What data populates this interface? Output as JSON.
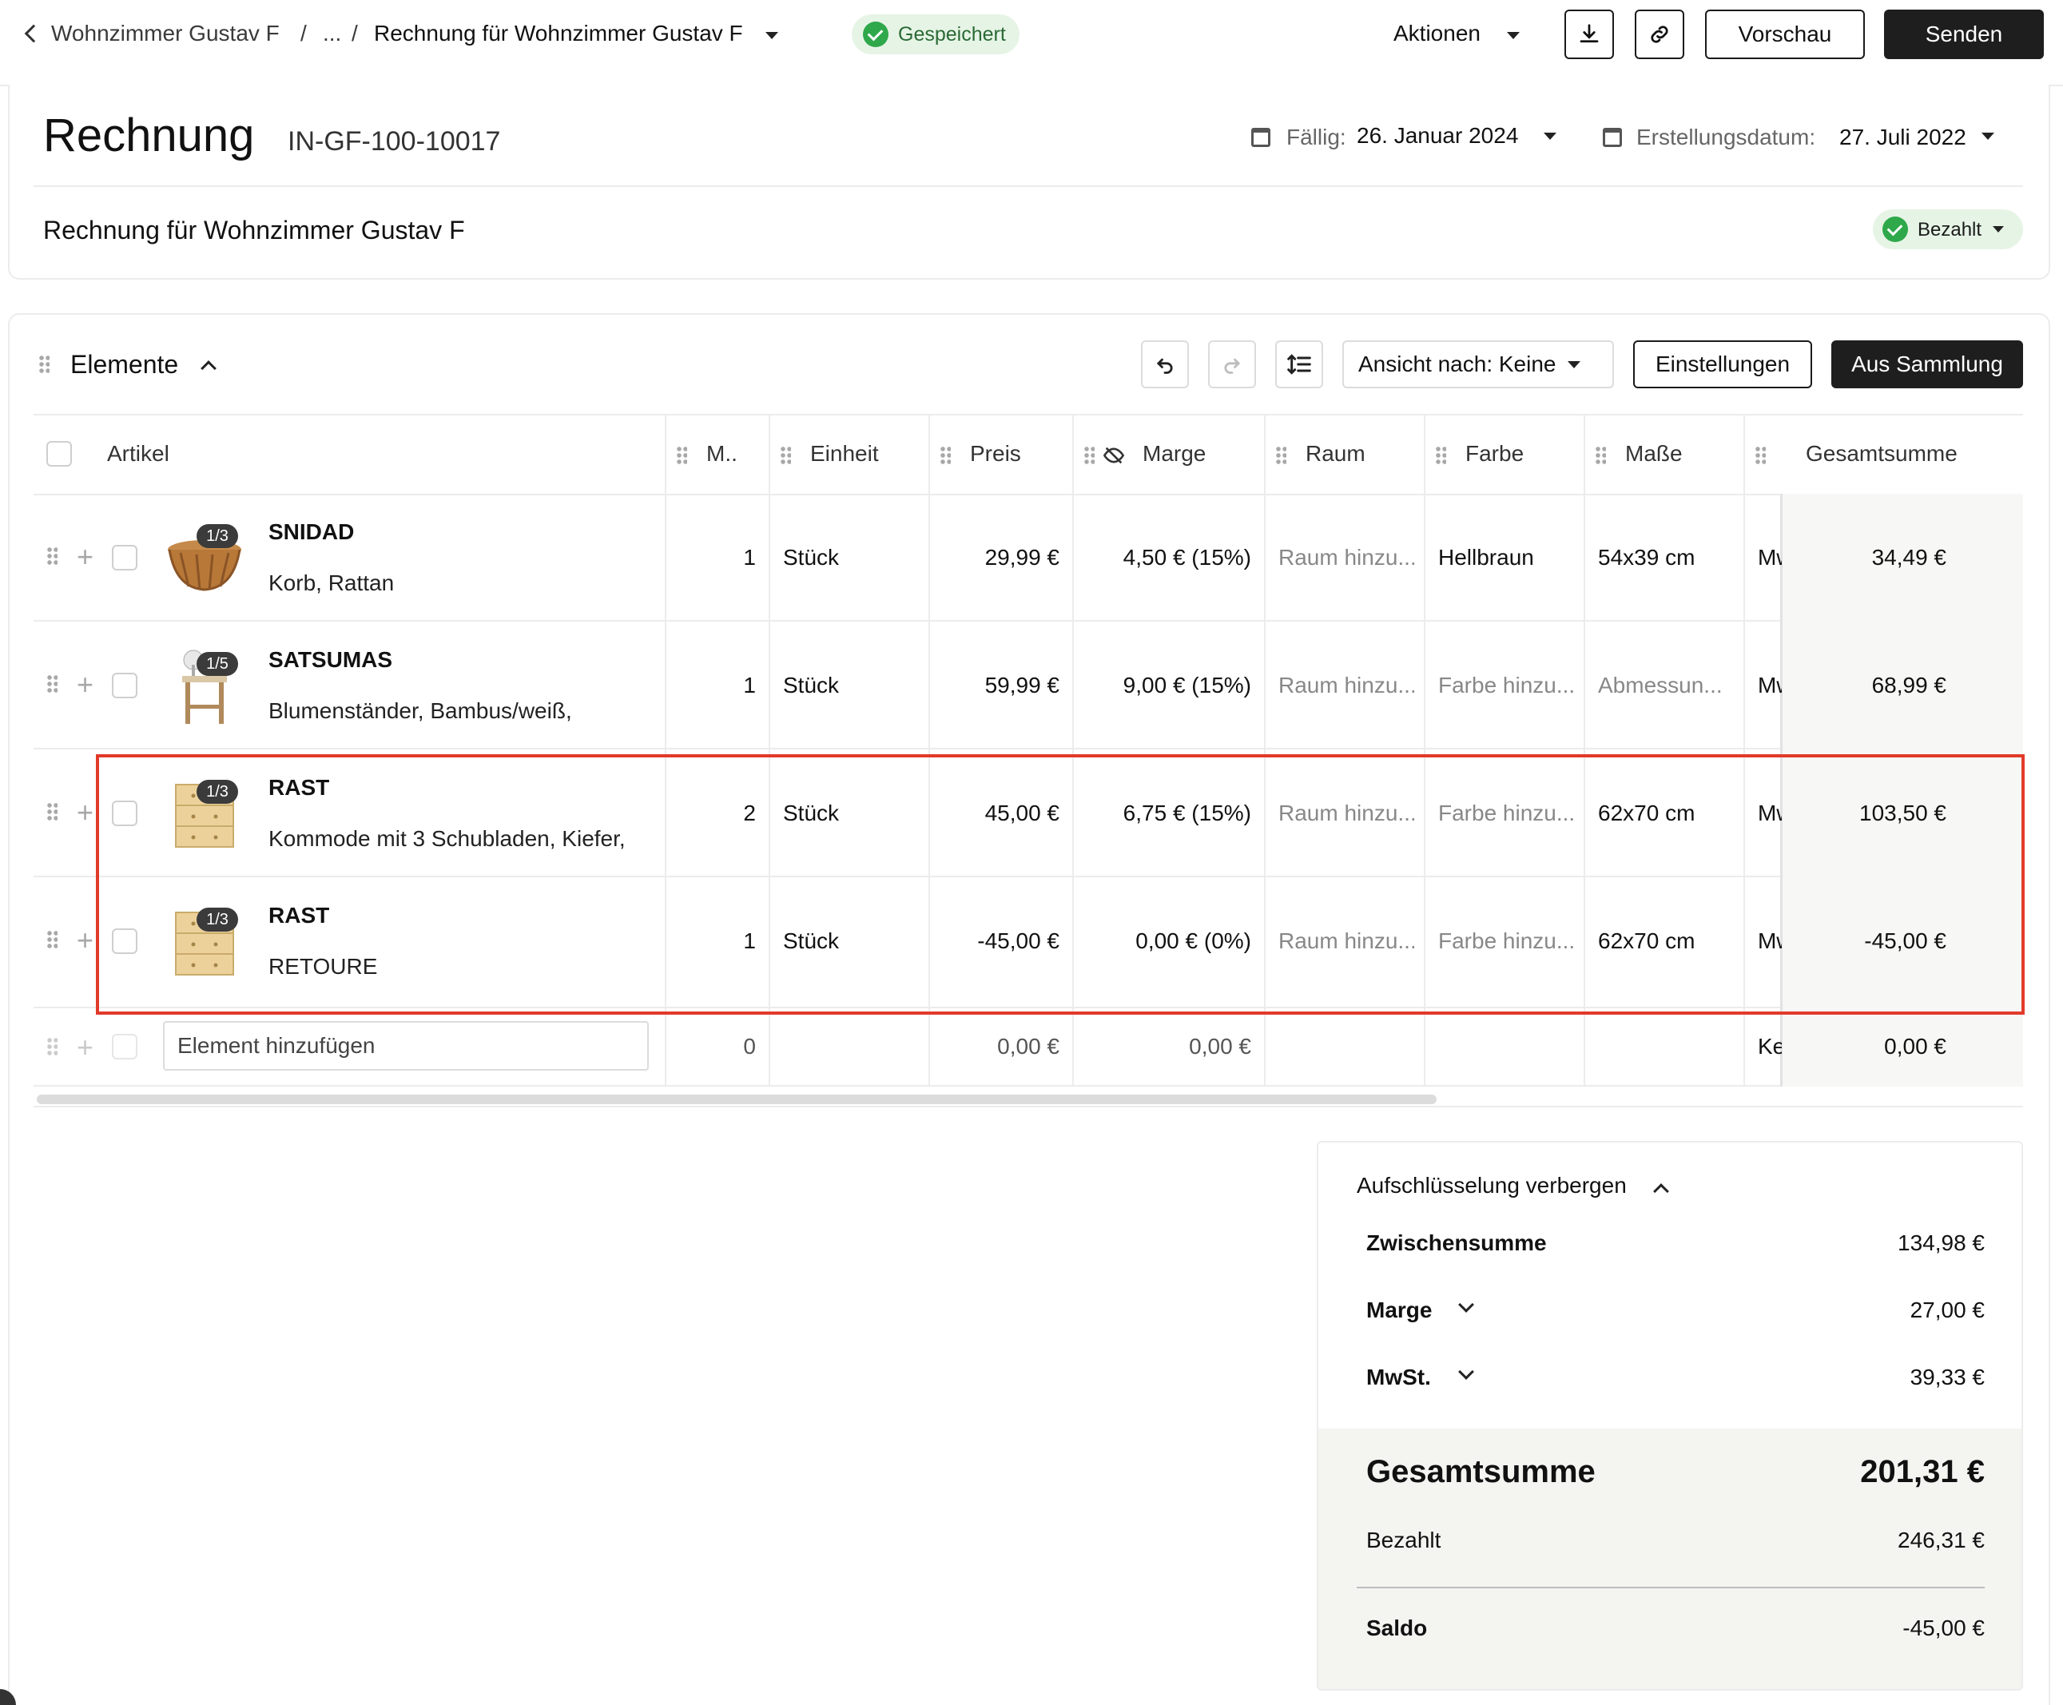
{
  "breadcrumb": {
    "parent": "Wohnzimmer Gustav F",
    "ellipsis": "...",
    "sep1": "/",
    "sep2": "/",
    "current": "Rechnung für Wohnzimmer Gustav F"
  },
  "save_status": "Gespeichert",
  "toolbar": {
    "actions": "Aktionen",
    "preview": "Vorschau",
    "send": "Senden"
  },
  "invoice": {
    "title": "Rechnung",
    "number": "IN-GF-100-10017",
    "due_label": "Fällig:",
    "due_value": "26. Januar 2024",
    "created_label": "Erstellungsdatum:",
    "created_value": "27. Juli 2022",
    "subtitle": "Rechnung für Wohnzimmer Gustav F",
    "status": "Bezahlt"
  },
  "elements": {
    "heading": "Elemente",
    "view_by": "Ansicht nach: Keine",
    "settings": "Einstellungen",
    "from_collection": "Aus Sammlung"
  },
  "columns": {
    "article": "Artikel",
    "qty": "M..",
    "unit": "Einheit",
    "price": "Preis",
    "margin": "Marge",
    "room": "Raum",
    "color": "Farbe",
    "dims": "Maße",
    "total": "Gesamtsumme"
  },
  "rows": [
    {
      "name": "SNIDAD",
      "desc": "Korb, Rattan",
      "badge": "1/3",
      "qty": "1",
      "unit": "Stück",
      "price": "29,99 €",
      "margin": "4,50 € (15%)",
      "room": "Raum hinzu...",
      "color": "Hellbraun",
      "dims": "54x39 cm",
      "tax": "Mw",
      "total": "34,49 €"
    },
    {
      "name": "SATSUMAS",
      "desc": "Blumenständer, Bambus/weiß,",
      "badge": "1/5",
      "qty": "1",
      "unit": "Stück",
      "price": "59,99 €",
      "margin": "9,00 € (15%)",
      "room": "Raum hinzu...",
      "color": "Farbe hinzu...",
      "dims": "Abmessun...",
      "tax": "Mw",
      "total": "68,99 €"
    },
    {
      "name": "RAST",
      "desc": "Kommode mit 3 Schubladen, Kiefer,",
      "badge": "1/3",
      "qty": "2",
      "unit": "Stück",
      "price": "45,00 €",
      "margin": "6,75 € (15%)",
      "room": "Raum hinzu...",
      "color": "Farbe hinzu...",
      "dims": "62x70 cm",
      "tax": "Mw",
      "total": "103,50 €"
    },
    {
      "name": "RAST",
      "desc": "RETOURE",
      "badge": "1/3",
      "qty": "1",
      "unit": "Stück",
      "price": "-45,00 €",
      "margin": "0,00 € (0%)",
      "room": "Raum hinzu...",
      "color": "Farbe hinzu...",
      "dims": "62x70 cm",
      "tax": "Mw",
      "total": "-45,00 €"
    }
  ],
  "add_row": {
    "placeholder": "Element hinzufügen",
    "qty": "0",
    "price": "0,00 €",
    "margin": "0,00 €",
    "tax": "Ke",
    "total": "0,00 €"
  },
  "summary": {
    "toggle": "Aufschlüsselung verbergen",
    "subtotal_label": "Zwischensumme",
    "subtotal": "134,98 €",
    "margin_label": "Marge",
    "margin": "27,00 €",
    "vat_label": "MwSt.",
    "vat": "39,33 €",
    "total_label": "Gesamtsumme",
    "total": "201,31 €",
    "paid_label": "Bezahlt",
    "paid": "246,31 €",
    "balance_label": "Saldo",
    "balance": "-45,00 €"
  },
  "colors": {
    "accent": "#1e1e1e",
    "success": "#2ea84a",
    "highlight": "#e23a2a"
  }
}
